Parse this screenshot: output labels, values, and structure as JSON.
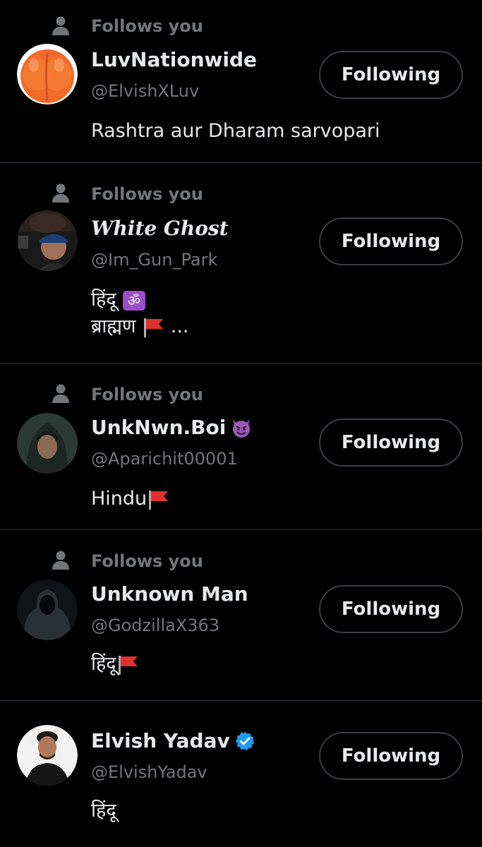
{
  "follows_you_label": "Follows you",
  "button_label": "Following",
  "accounts": [
    {
      "name": "LuvNationwide",
      "handle": "@ElvishXLuv",
      "bio_lines": [
        "Rashtra aur Dharam sarvopari"
      ],
      "follows_you": true
    },
    {
      "name": "White Ghost",
      "handle": "@Im_Gun_Park",
      "bio_lines": [
        "हिंदू",
        "ब्राह्मण",
        "..."
      ],
      "follows_you": true
    },
    {
      "name": "UnkNwn.Boi",
      "handle": "@Aparichit00001",
      "bio_lines": [
        "Hindu"
      ],
      "follows_you": true
    },
    {
      "name": "Unknown Man",
      "handle": "@GodzillaX363",
      "bio_lines": [
        "हिंदू"
      ],
      "follows_you": true
    },
    {
      "name": "Elvish Yadav",
      "handle": "@ElvishYadav",
      "bio_lines": [
        "हिंदू"
      ],
      "follows_you": false,
      "verified": true
    }
  ],
  "icons": {
    "person": "person-icon",
    "verified": "verified-badge-icon",
    "flag": "red-flag-icon",
    "om": "om-symbol-icon",
    "devil": "smiling-devil-icon"
  },
  "colors": {
    "background": "#000000",
    "primary_text": "#e7e9ea",
    "secondary_text": "#71767b",
    "divider": "#2f3336",
    "verified_blue": "#1d9bf0"
  }
}
